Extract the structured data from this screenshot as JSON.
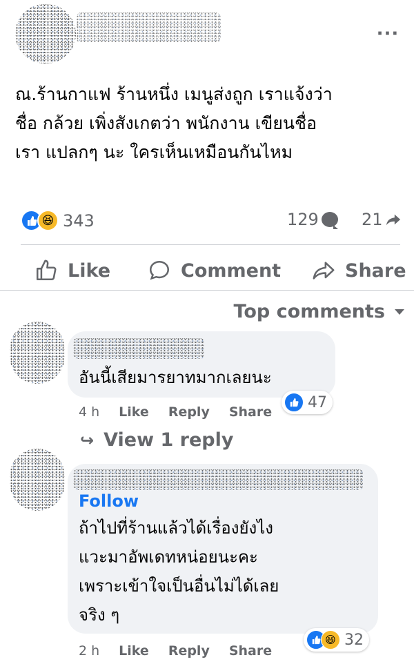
{
  "post": {
    "more_icon": "more-horizontal-icon",
    "text_lines": [
      "ณ.ร้านกาแฟ ร้านหนึ่ง เมนูส่งถูก เราแจ้งว่า",
      "ชื่อ กล้วย เพิ่งสังเกตว่า พนักงาน เขียนชื่อ",
      "เรา แปลกๆ นะ ใครเห็นเหมือนกันไหม"
    ],
    "reaction_count": "343",
    "comment_count": "129",
    "share_count": "21"
  },
  "actions": {
    "like": "Like",
    "comment": "Comment",
    "share": "Share"
  },
  "sort": {
    "label": "Top comments"
  },
  "comments": [
    {
      "text_lines": [
        "อันนี้เสียมารยาทมากเลยนะ"
      ],
      "reaction_count": "47",
      "time": "4 h",
      "like": "Like",
      "reply": "Reply",
      "share": "Share"
    },
    {
      "follow": "Follow",
      "text_lines": [
        "ถ้าไปที่ร้านแล้วได้เรื่องยังไง",
        "แวะมาอัพเดทหน่อยนะคะ",
        "เพราะเข้าใจเป็นอื่นไม่ได้เลย",
        "จริง ๆ"
      ],
      "reaction_count": "32",
      "time": "2 h",
      "like": "Like",
      "reply": "Reply",
      "share": "Share"
    }
  ],
  "view_reply": {
    "label": "View 1 reply"
  },
  "colors": {
    "accent": "#1877f2",
    "secondary_text": "#65676b",
    "bubble_bg": "#f0f2f5"
  }
}
